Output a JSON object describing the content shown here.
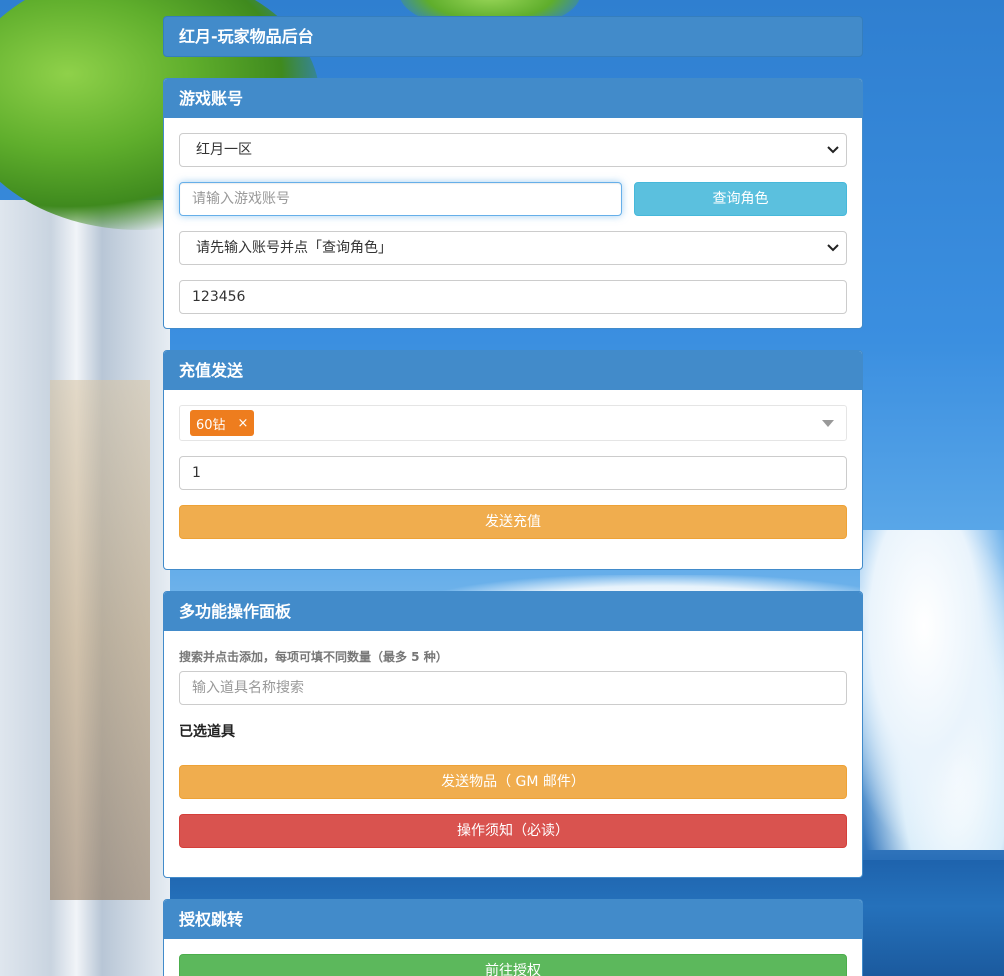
{
  "header": {
    "title": "红月-玩家物品后台"
  },
  "account_panel": {
    "heading": "游戏账号",
    "server_select": {
      "value": "红月一区"
    },
    "account_input": {
      "placeholder": "请输入游戏账号",
      "value": ""
    },
    "query_button": "查询角色",
    "role_select": {
      "value": "请先输入账号并点「查询角色」"
    },
    "password_input": {
      "value": "123456"
    }
  },
  "recharge_panel": {
    "heading": "充值发送",
    "selected_tags": [
      {
        "label": "60钻",
        "remove": "×"
      }
    ],
    "quantity_input": {
      "value": "1"
    },
    "send_button": "发送充值"
  },
  "multi_panel": {
    "heading": "多功能操作面板",
    "hint": "搜索并点击添加，每项可填不同数量（最多 5 种）",
    "search_input": {
      "placeholder": "输入道具名称搜索"
    },
    "selected_label": "已选道具",
    "send_items_button": "发送物品（ GM 邮件）",
    "notice_button": "操作须知（必读）"
  },
  "auth_panel": {
    "heading": "授权跳转",
    "go_button": "前往授权"
  },
  "colors": {
    "primary": "#428bca",
    "info": "#5bc0de",
    "warning": "#f0ad4e",
    "danger": "#d9534f",
    "success": "#5cb85c",
    "tag": "#ee7d1e"
  },
  "icons": [
    "chevron-down-icon",
    "close-icon",
    "caret-down-icon"
  ]
}
